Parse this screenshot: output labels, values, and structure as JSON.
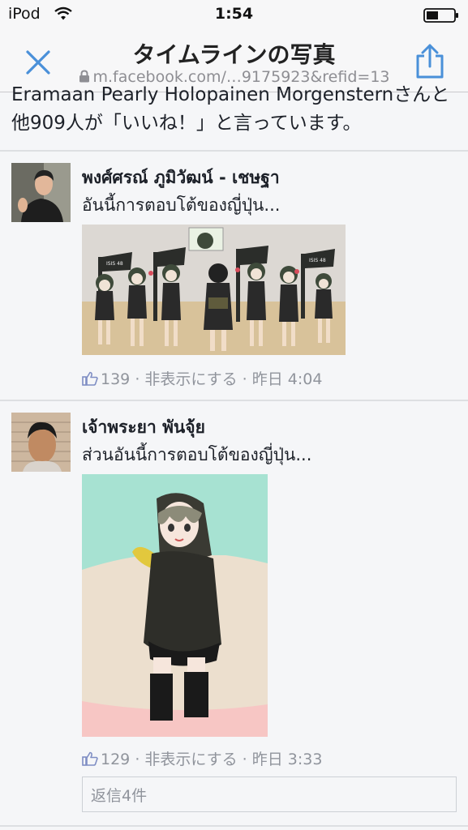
{
  "status_bar": {
    "carrier": "iPod",
    "time": "1:54"
  },
  "nav": {
    "title": "タイムラインの写真",
    "url": "m.facebook.com/…9175923&refid=13"
  },
  "likes_summary": "Eramaan Pearly Holopainen Morgensternさんと他909人が「いいね！」と言っています。",
  "comments": [
    {
      "author": "พงศ์ศรณ์ ภูมิวัฒน์ - เชษฐา",
      "text": "อันนี้การตอบโต้ของญี่ปุ่น...",
      "image_text": "ISIS 48",
      "likes": "139",
      "hide_label": "非表示にする",
      "time": "昨日 4:04"
    },
    {
      "author": "เจ้าพระยา พันจุ้ย",
      "text": "ส่วนอันนี้การตอบโต้ของญี่ปุ่น...",
      "likes": "129",
      "hide_label": "非表示にする",
      "time": "昨日 3:33",
      "replies": "返信4件"
    }
  ],
  "separator": "·",
  "colors": {
    "accent": "#4a90d9",
    "meta": "#90949c",
    "link": "#1d2129"
  },
  "icons": [
    "wifi-icon",
    "battery-icon",
    "close-icon",
    "lock-icon",
    "share-icon",
    "like-icon"
  ]
}
